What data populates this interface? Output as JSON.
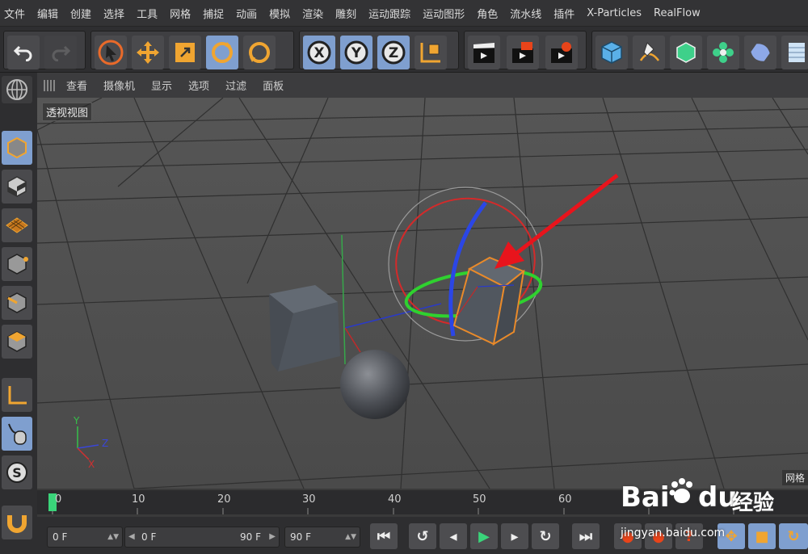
{
  "menubar": {
    "items": [
      "文件",
      "编辑",
      "创建",
      "选择",
      "工具",
      "网格",
      "捕捉",
      "动画",
      "模拟",
      "渲染",
      "雕刻",
      "运动跟踪",
      "运动图形",
      "角色",
      "流水线",
      "插件",
      "X-Particles",
      "RealFlow"
    ]
  },
  "viewport": {
    "view_menu": [
      "查看",
      "摄像机",
      "显示",
      "选项",
      "过滤",
      "面板"
    ],
    "label": "透视视图",
    "grid_label": "网格",
    "axis_labels": {
      "y": "Y",
      "z": "Z",
      "x": "X"
    }
  },
  "timeline": {
    "ticks": [
      "0",
      "10",
      "20",
      "30",
      "40",
      "50",
      "60"
    ],
    "current_frame": 0
  },
  "transport": {
    "current_frame_field": "0 F",
    "range_start": "0 F",
    "range_end": "90 F",
    "end_frame_field": "90 F"
  },
  "watermark": {
    "brand_left": "Bai",
    "brand_right": "du",
    "brand_cn": "经验",
    "url": "jingyan.baidu.com"
  },
  "colors": {
    "accent_blue": "#7f9fcf",
    "orange": "#e98a2a",
    "arrow_red": "#e8141c",
    "playhead_green": "#3ad47a"
  }
}
